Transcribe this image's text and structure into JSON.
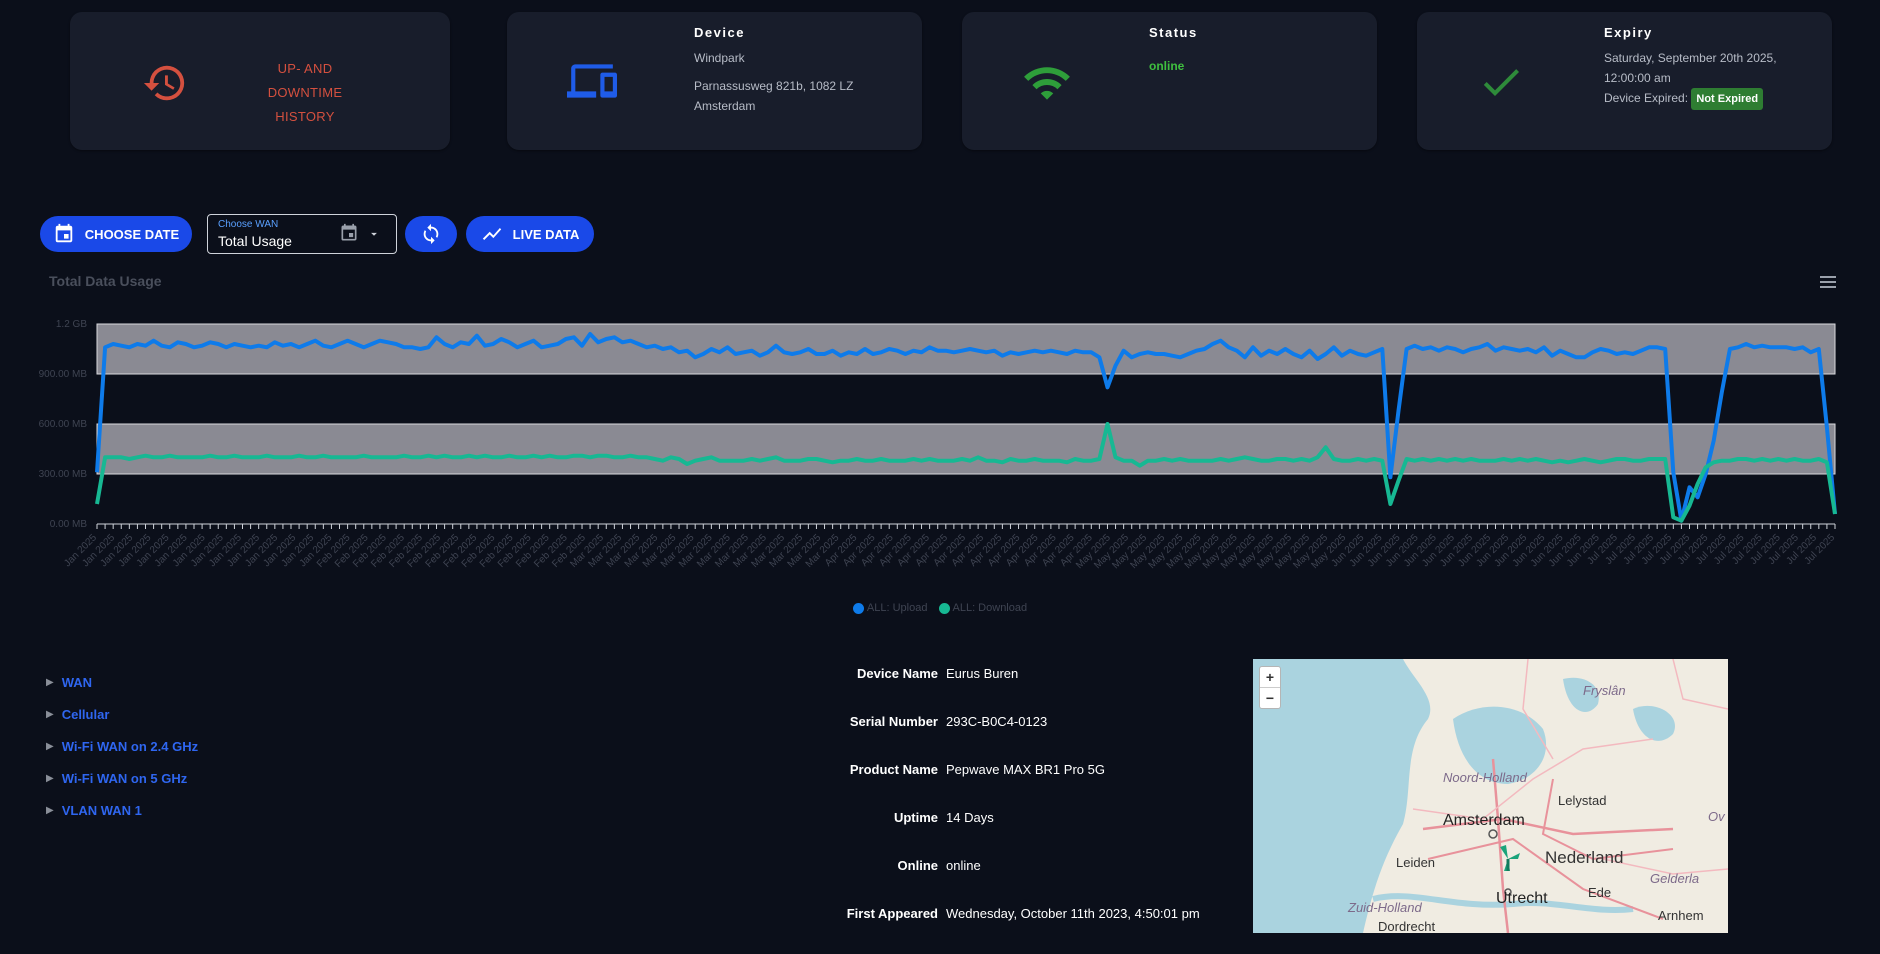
{
  "cards": {
    "history": {
      "label_line1": "UP- AND DOWNTIME",
      "label_line2": "HISTORY"
    },
    "device": {
      "title": "Device",
      "name": "Windpark",
      "address_line1": "Parnassusweg 821b, 1082 LZ",
      "address_line2": "Amsterdam"
    },
    "status": {
      "title": "Status",
      "value": "online"
    },
    "expiry": {
      "title": "Expiry",
      "date_line1": "Saturday, September 20th 2025,",
      "date_line2": "12:00:00 am",
      "expired_label": "Device Expired:",
      "badge": "Not Expired"
    }
  },
  "toolbar": {
    "choose_date": "CHOOSE DATE",
    "wan_label": "Choose WAN",
    "wan_value": "Total Usage",
    "live_data": "LIVE DATA"
  },
  "chart_data": {
    "type": "line",
    "title": "Total Data Usage",
    "y_ticks": [
      "0.00 MB",
      "300.00 MB",
      "600.00 MB",
      "900.00 MB",
      "1.2 GB"
    ],
    "ylim": [
      0,
      1200
    ],
    "x_range": [
      "Jan 2025",
      "Jul 2025"
    ],
    "x_tick_label_sample": [
      "Jan 2025",
      "Feb 2025",
      "Mar 2025",
      "Apr 2025",
      "May 2025",
      "Jun 2025",
      "Jul 2025"
    ],
    "bands": [
      [
        300,
        600
      ],
      [
        900,
        1200
      ]
    ],
    "legend": [
      "ALL: Upload",
      "ALL: Download"
    ],
    "series": [
      {
        "name": "ALL: Upload",
        "color": "#0e7bea",
        "values": [
          310,
          1060,
          1080,
          1070,
          1060,
          1080,
          1070,
          1100,
          1070,
          1060,
          1090,
          1080,
          1060,
          1070,
          1090,
          1080,
          1060,
          1080,
          1070,
          1060,
          1070,
          1060,
          1090,
          1070,
          1080,
          1060,
          1080,
          1100,
          1070,
          1060,
          1080,
          1100,
          1080,
          1060,
          1080,
          1100,
          1090,
          1080,
          1060,
          1060,
          1050,
          1060,
          1120,
          1080,
          1060,
          1090,
          1080,
          1130,
          1070,
          1080,
          1110,
          1090,
          1060,
          1080,
          1100,
          1060,
          1070,
          1080,
          1110,
          1120,
          1070,
          1140,
          1090,
          1110,
          1120,
          1090,
          1100,
          1080,
          1060,
          1070,
          1050,
          1060,
          1030,
          1040,
          1000,
          1020,
          1050,
          1030,
          1060,
          1020,
          1030,
          1040,
          1010,
          1030,
          1070,
          1030,
          1020,
          1030,
          1050,
          1020,
          1020,
          1040,
          1010,
          1030,
          1020,
          1050,
          1020,
          1030,
          1050,
          1040,
          1020,
          1040,
          1030,
          1060,
          1040,
          1040,
          1030,
          1040,
          1050,
          1040,
          1030,
          1040,
          1010,
          1030,
          1020,
          1030,
          1040,
          1030,
          1040,
          1030,
          1020,
          1040,
          1030,
          1030,
          1000,
          820,
          950,
          1040,
          1000,
          1020,
          1030,
          1020,
          1020,
          1010,
          1000,
          1020,
          1040,
          1050,
          1080,
          1100,
          1060,
          1040,
          1000,
          1060,
          1010,
          1040,
          1020,
          1050,
          1020,
          1000,
          1040,
          990,
          1020,
          1060,
          1010,
          1040,
          1020,
          1010,
          1030,
          1050,
          280,
          680,
          1050,
          1070,
          1050,
          1060,
          1040,
          1060,
          1050,
          1030,
          1050,
          1060,
          1080,
          1040,
          1060,
          1050,
          1040,
          1050,
          1030,
          1060,
          1010,
          1040,
          1020,
          1000,
          1000,
          1030,
          1050,
          1040,
          1020,
          1030,
          1020,
          1040,
          1060,
          1060,
          1050,
          310,
          20,
          220,
          160,
          300,
          500,
          790,
          1050,
          1060,
          1080,
          1060,
          1070,
          1060,
          1060,
          1060,
          1050,
          1060,
          1030,
          1050,
          580,
          60
        ]
      },
      {
        "name": "ALL: Download",
        "color": "#17b893",
        "values": [
          120,
          400,
          400,
          400,
          390,
          400,
          410,
          400,
          400,
          410,
          400,
          400,
          400,
          400,
          410,
          400,
          400,
          410,
          400,
          400,
          400,
          410,
          400,
          400,
          400,
          410,
          400,
          400,
          410,
          400,
          400,
          400,
          400,
          410,
          400,
          400,
          400,
          400,
          410,
          400,
          400,
          410,
          400,
          410,
          400,
          400,
          410,
          400,
          410,
          400,
          400,
          410,
          400,
          400,
          410,
          400,
          410,
          400,
          400,
          410,
          410,
          400,
          410,
          410,
          400,
          400,
          410,
          400,
          400,
          390,
          380,
          400,
          390,
          360,
          380,
          390,
          400,
          380,
          380,
          380,
          380,
          390,
          380,
          390,
          400,
          380,
          380,
          380,
          390,
          390,
          380,
          370,
          380,
          380,
          390,
          380,
          380,
          390,
          380,
          380,
          380,
          390,
          380,
          390,
          380,
          380,
          380,
          390,
          380,
          400,
          380,
          380,
          370,
          390,
          380,
          380,
          390,
          380,
          380,
          380,
          370,
          390,
          380,
          380,
          390,
          600,
          400,
          380,
          380,
          350,
          380,
          380,
          390,
          380,
          390,
          380,
          380,
          380,
          380,
          390,
          380,
          390,
          400,
          390,
          380,
          380,
          390,
          390,
          380,
          390,
          380,
          400,
          460,
          390,
          380,
          380,
          390,
          380,
          390,
          380,
          120,
          260,
          390,
          380,
          390,
          380,
          390,
          380,
          390,
          380,
          390,
          380,
          380,
          380,
          390,
          380,
          390,
          380,
          390,
          380,
          370,
          380,
          370,
          380,
          390,
          380,
          370,
          380,
          390,
          390,
          380,
          380,
          390,
          390,
          390,
          40,
          20,
          110,
          240,
          340,
          370,
          380,
          380,
          390,
          390,
          380,
          390,
          380,
          390,
          380,
          390,
          380,
          380,
          390,
          370,
          60
        ]
      }
    ]
  },
  "tree": [
    {
      "label": "WAN"
    },
    {
      "label": "Cellular"
    },
    {
      "label": "Wi-Fi WAN on 2.4 GHz"
    },
    {
      "label": "Wi-Fi WAN on 5 GHz"
    },
    {
      "label": "VLAN WAN 1"
    }
  ],
  "info": [
    {
      "key": "Device Name",
      "value": "Eurus Buren"
    },
    {
      "key": "Serial Number",
      "value": "293C-B0C4-0123"
    },
    {
      "key": "Product Name",
      "value": "Pepwave MAX BR1 Pro 5G"
    },
    {
      "key": "Uptime",
      "value": "14 Days"
    },
    {
      "key": "Online",
      "value": "online"
    },
    {
      "key": "First Appeared",
      "value": "Wednesday, October 11th 2023, 4:50:01 pm"
    }
  ],
  "map": {
    "zoom_in": "+",
    "zoom_out": "−",
    "labels": {
      "friesland": "Fryslân",
      "noord_holland": "Noord-Holland",
      "lelystad": "Lelystad",
      "amsterdam": "Amsterdam",
      "leiden": "Leiden",
      "nederland": "Nederland",
      "zuid_holland": "Zuid-Holland",
      "utrecht": "Utrecht",
      "ede": "Ede",
      "gelderland": "Gelderla",
      "arnhem": "Arnhem",
      "dordrecht": "Dordrecht",
      "ov": "Ov"
    }
  }
}
